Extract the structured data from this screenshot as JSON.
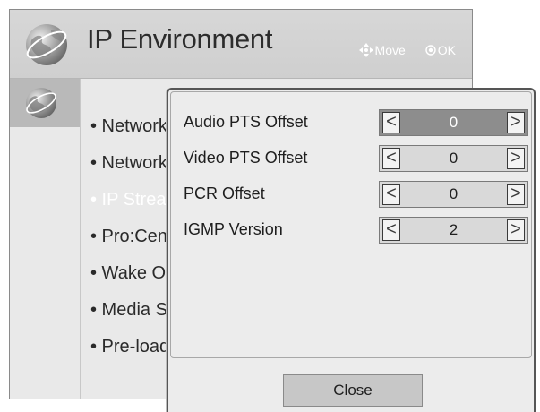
{
  "window": {
    "title": "IP Environment",
    "hints": {
      "move_label": "Move",
      "ok_label": "OK"
    }
  },
  "menu": {
    "items": [
      {
        "label": "• Network Setting"
      },
      {
        "label": "• Network Status"
      },
      {
        "label": "• IP Stream Setting",
        "state": "dimmed"
      },
      {
        "label": "• Pro:Centric"
      },
      {
        "label": "• Wake On LAN"
      },
      {
        "label": "• Media Share"
      },
      {
        "label": "• Pre-load Setting"
      }
    ]
  },
  "popup": {
    "rows": [
      {
        "label": "Audio PTS Offset",
        "value": "0",
        "left_arrow": "<",
        "right_arrow": ">",
        "focused": true
      },
      {
        "label": "Video PTS Offset",
        "value": "0",
        "left_arrow": "<",
        "right_arrow": ">",
        "focused": false
      },
      {
        "label": "PCR Offset",
        "value": "0",
        "left_arrow": "<",
        "right_arrow": ">",
        "focused": false
      },
      {
        "label": "IGMP Version",
        "value": "2",
        "left_arrow": "<",
        "right_arrow": ">",
        "focused": false
      }
    ],
    "close_label": "Close"
  },
  "icons": {
    "title_icon": "globe-icon",
    "sidebar_icon": "globe-icon",
    "move_icon": "four-way-arrow-icon",
    "ok_icon": "ok-circle-icon"
  },
  "colors": {
    "focused_stepper": "#8d8d8d",
    "stepper": "#d9d9d9",
    "popup_border": "#555555",
    "menu_dimmed_text": "#ffffff"
  }
}
